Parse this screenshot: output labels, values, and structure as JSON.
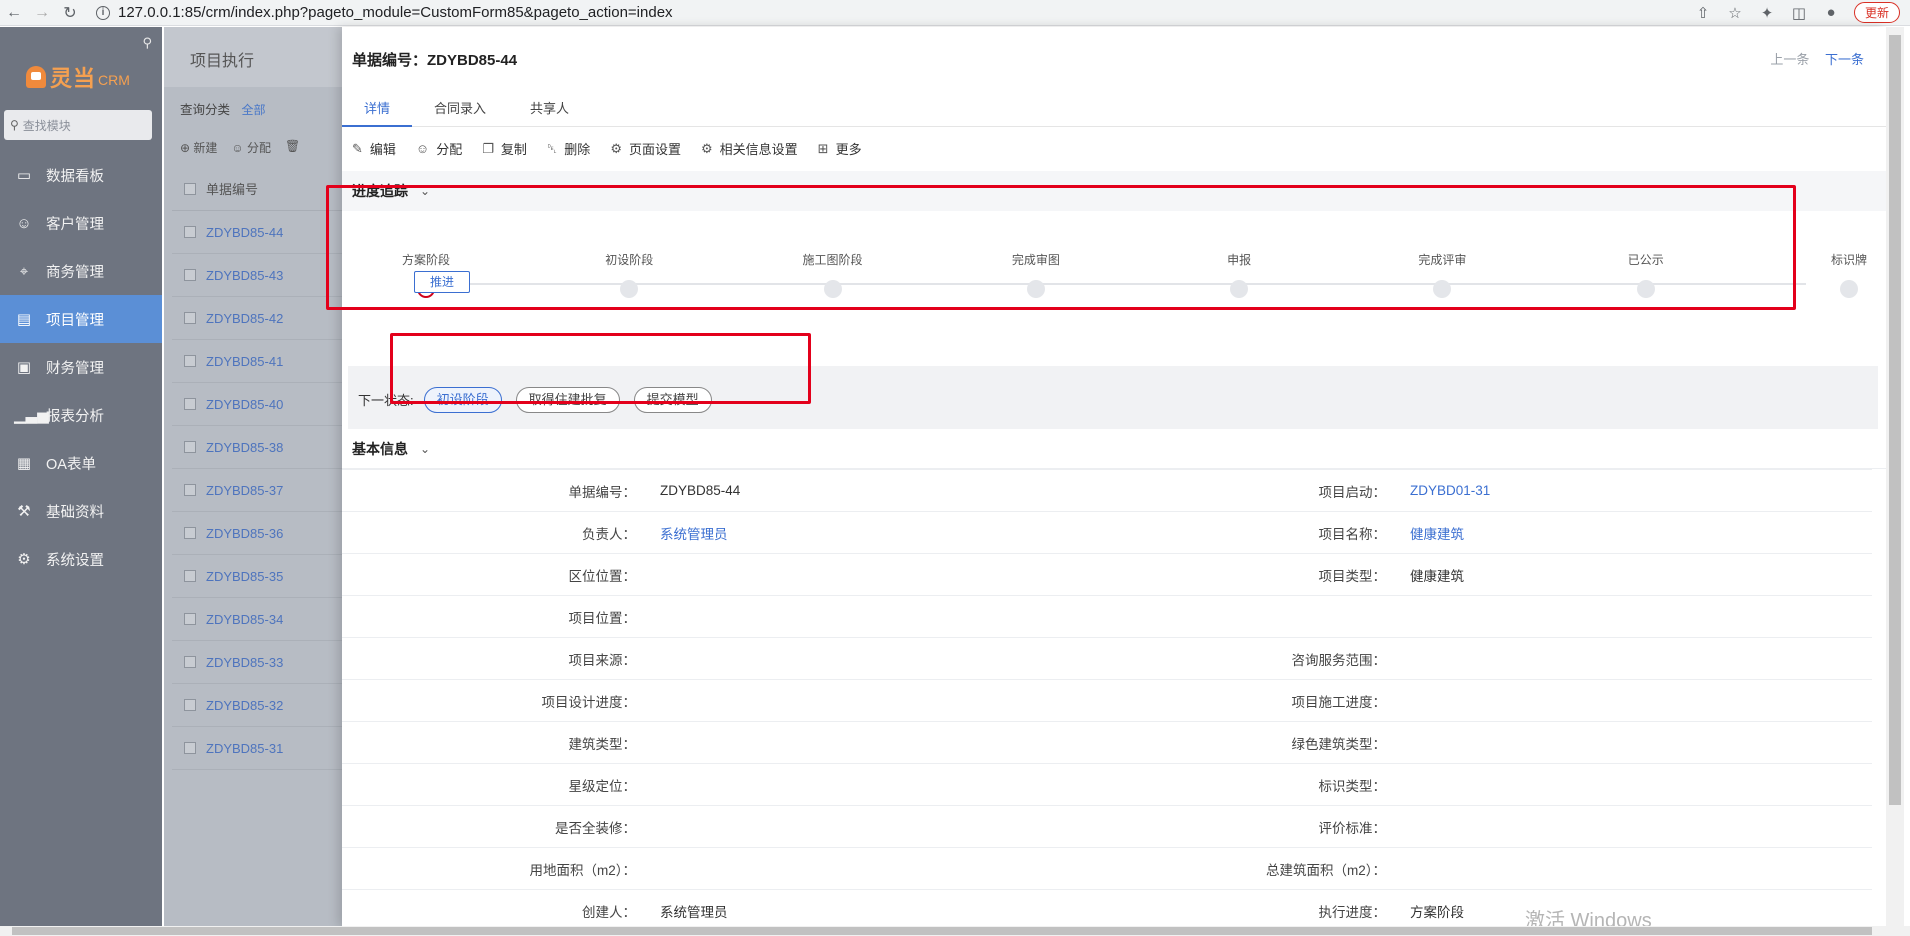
{
  "browser": {
    "url": "127.0.0.1:85/crm/index.php?pageto_module=CustomForm85&pageto_action=index",
    "update_label": "更新"
  },
  "sidebar": {
    "logo_text": "灵当",
    "logo_sub": "CRM",
    "search_placeholder": "查找模块",
    "items": [
      {
        "label": "数据看板",
        "icon": "monitor-icon"
      },
      {
        "label": "客户管理",
        "icon": "user-icon"
      },
      {
        "label": "商务管理",
        "icon": "target-icon"
      },
      {
        "label": "项目管理",
        "icon": "folder-icon"
      },
      {
        "label": "财务管理",
        "icon": "briefcase-icon"
      },
      {
        "label": "报表分析",
        "icon": "bar-chart-icon"
      },
      {
        "label": "OA表单",
        "icon": "calendar-icon"
      },
      {
        "label": "基础资料",
        "icon": "wrench-icon"
      },
      {
        "label": "系统设置",
        "icon": "gear-icon"
      }
    ],
    "active_index": 3
  },
  "list": {
    "title": "项目执行",
    "filter_label": "查询分类",
    "filter_value": "全部",
    "tools": [
      "新建",
      "分配"
    ],
    "column": "单据编号",
    "rows": [
      "ZDYBD85-44",
      "ZDYBD85-43",
      "ZDYBD85-42",
      "ZDYBD85-41",
      "ZDYBD85-40",
      "ZDYBD85-38",
      "ZDYBD85-37",
      "ZDYBD85-36",
      "ZDYBD85-35",
      "ZDYBD85-34",
      "ZDYBD85-33",
      "ZDYBD85-32",
      "ZDYBD85-31"
    ]
  },
  "panel": {
    "title": "单据编号：ZDYBD85-44",
    "prev": "上一条",
    "next": "下一条",
    "tabs": [
      "详情",
      "合同录入",
      "共享人"
    ],
    "toolbar": [
      {
        "label": "编辑",
        "icon": "edit-icon"
      },
      {
        "label": "分配",
        "icon": "user-icon"
      },
      {
        "label": "复制",
        "icon": "copy-icon"
      },
      {
        "label": "删除",
        "icon": "trash-icon"
      },
      {
        "label": "页面设置",
        "icon": "settings-icon"
      },
      {
        "label": "相关信息设置",
        "icon": "gear-icon"
      },
      {
        "label": "更多",
        "icon": "grid-icon"
      }
    ],
    "progress_title": "进度追踪",
    "stages": [
      "方案阶段",
      "初设阶段",
      "施工图阶段",
      "完成审图",
      "申报",
      "完成评审",
      "已公示",
      "标识牌"
    ],
    "current_stage_index": 0,
    "advance_label": "推进",
    "next_state_label": "下一状态:",
    "next_states": [
      "初设阶段",
      "取得住建批复",
      "提交模型"
    ],
    "basic_title": "基本信息",
    "fields": [
      {
        "l1": "单据编号：",
        "v1": "ZDYBD85-44",
        "v1_link": false,
        "l2": "项目启动：",
        "v2": "ZDYBD01-31",
        "v2_link": true
      },
      {
        "l1": "负责人：",
        "v1": "系统管理员",
        "v1_link": true,
        "l2": "项目名称：",
        "v2": "健康建筑",
        "v2_link": true
      },
      {
        "l1": "区位位置：",
        "v1": "",
        "v1_link": false,
        "l2": "项目类型：",
        "v2": "健康建筑",
        "v2_link": false
      },
      {
        "l1": "项目位置：",
        "v1": "",
        "v1_link": false,
        "l2": "",
        "v2": "",
        "v2_link": false
      },
      {
        "l1": "项目来源：",
        "v1": "",
        "v1_link": false,
        "l2": "咨询服务范围：",
        "v2": "",
        "v2_link": false
      },
      {
        "l1": "项目设计进度：",
        "v1": "",
        "v1_link": false,
        "l2": "项目施工进度：",
        "v2": "",
        "v2_link": false
      },
      {
        "l1": "建筑类型：",
        "v1": "",
        "v1_link": false,
        "l2": "绿色建筑类型：",
        "v2": "",
        "v2_link": false
      },
      {
        "l1": "星级定位：",
        "v1": "",
        "v1_link": false,
        "l2": "标识类型：",
        "v2": "",
        "v2_link": false
      },
      {
        "l1": "是否全装修：",
        "v1": "",
        "v1_link": false,
        "l2": "评价标准：",
        "v2": "",
        "v2_link": false
      },
      {
        "l1": "用地面积（m2）：",
        "v1": "",
        "v1_link": false,
        "l2": "总建筑面积（m2）：",
        "v2": "",
        "v2_link": false
      },
      {
        "l1": "创建人：",
        "v1": "系统管理员",
        "v1_link": false,
        "l2": "执行进度：",
        "v2": "方案阶段",
        "v2_link": false
      }
    ]
  },
  "watermark": "激活 Windows"
}
